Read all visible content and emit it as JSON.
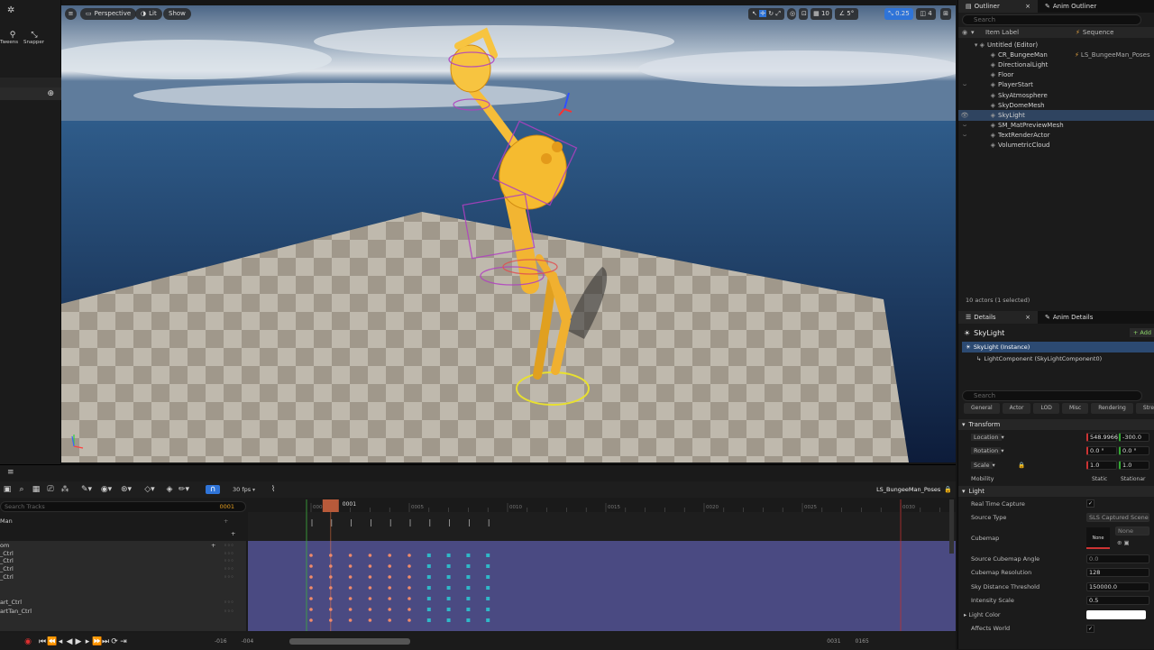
{
  "left_strip": {
    "tweens_label": "Tweens",
    "snapper_label": "Snapper"
  },
  "viewport": {
    "view_mode": "Perspective",
    "lit_mode": "Lit",
    "show_label": "Show",
    "grid_snap": "10",
    "rot_snap": "5°",
    "scale_snap": "0.25",
    "cam_speed": "4"
  },
  "outliner": {
    "tab_outliner": "Outliner",
    "tab_anim": "Anim Outliner",
    "search_placeholder": "Search",
    "col_item": "Item Label",
    "col_seq": "Sequence",
    "items": [
      {
        "label": "Untitled (Editor)",
        "seq": ""
      },
      {
        "label": "CR_BungeeMan",
        "seq": "LS_BungeeMan_Poses"
      },
      {
        "label": "DirectionalLight",
        "seq": ""
      },
      {
        "label": "Floor",
        "seq": ""
      },
      {
        "label": "PlayerStart",
        "seq": ""
      },
      {
        "label": "SkyAtmosphere",
        "seq": ""
      },
      {
        "label": "SkyDomeMesh",
        "seq": ""
      },
      {
        "label": "SkyLight",
        "seq": ""
      },
      {
        "label": "SM_MatPreviewMesh",
        "seq": ""
      },
      {
        "label": "TextRenderActor",
        "seq": ""
      },
      {
        "label": "VolumetricCloud",
        "seq": ""
      }
    ],
    "footer": "10 actors (1 selected)"
  },
  "details": {
    "tab_details": "Details",
    "tab_anim": "Anim Details",
    "actor_name": "SkyLight",
    "add_label": "+ Add",
    "instance": "SkyLight (Instance)",
    "component": "LightComponent (SkyLightComponent0)",
    "search_placeholder": "Search",
    "filters": [
      "General",
      "Actor",
      "LOD",
      "Misc",
      "Rendering",
      "Streaming"
    ],
    "transform_title": "Transform",
    "location_label": "Location",
    "location_x": "548.9966",
    "location_y": "-300.0",
    "rotation_label": "Rotation",
    "rotation_x": "0.0 °",
    "rotation_y": "0.0 °",
    "scale_label": "Scale",
    "scale_x": "1.0",
    "scale_y": "1.0",
    "mobility_label": "Mobility",
    "mobility_static": "Static",
    "mobility_stationary": "Stationar",
    "light_title": "Light",
    "real_time_capture": "Real Time Capture",
    "source_type_label": "Source Type",
    "source_type_value": "SLS Captured Scene",
    "cubemap_label": "Cubemap",
    "cubemap_none": "None",
    "cubemap_none2": "None",
    "source_cubemap_angle": "Source Cubemap Angle",
    "source_cubemap_angle_value": "0.0",
    "cubemap_resolution": "Cubemap Resolution",
    "cubemap_resolution_value": "128",
    "sky_distance_threshold": "Sky Distance Threshold",
    "sky_distance_threshold_value": "150000.0",
    "intensity_scale": "Intensity Scale",
    "intensity_scale_value": "0.5",
    "light_color": "Light Color",
    "affects_world": "Affects World"
  },
  "sequencer": {
    "fps": "30 fps",
    "sequence_name": "LS_BungeeMan_Poses",
    "search_placeholder": "Search Tracks",
    "current_frame_field": "0001",
    "playhead_label": "0001",
    "ruler_ticks": [
      "0000",
      "0005",
      "0010",
      "0015",
      "0020",
      "0025",
      "0030"
    ],
    "tracks": [
      "Man",
      "om",
      "_Ctrl",
      "_Ctrl",
      "_Ctrl",
      "_Ctrl",
      "art_Ctrl",
      "artTan_Ctrl"
    ],
    "range_start": "-016",
    "range_start2": "-004",
    "range_end": "0031",
    "range_end2": "0165"
  }
}
